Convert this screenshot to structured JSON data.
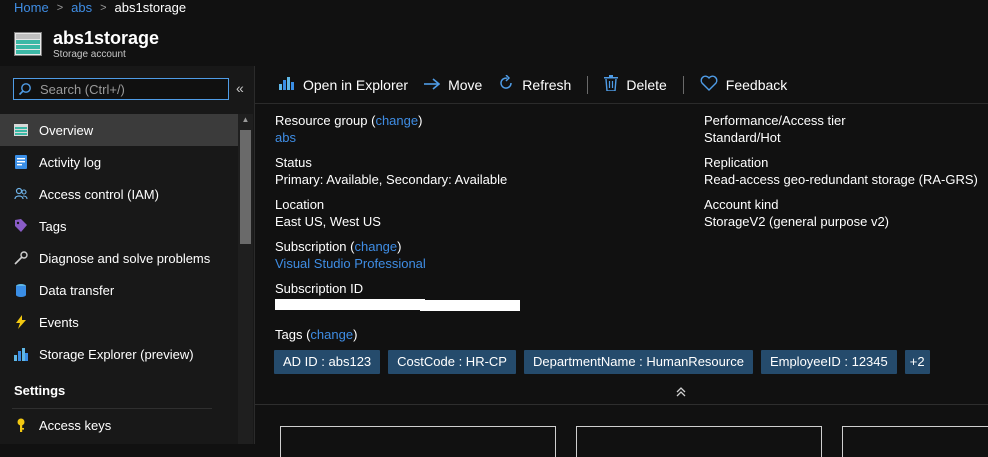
{
  "breadcrumb": {
    "home": "Home",
    "rg": "abs",
    "current": "abs1storage"
  },
  "header": {
    "title": "abs1storage",
    "subtitle": "Storage account"
  },
  "search": {
    "placeholder": "Search (Ctrl+/)"
  },
  "sidebar": {
    "items": [
      {
        "label": "Overview",
        "icon": "overview-icon",
        "active": true
      },
      {
        "label": "Activity log",
        "icon": "activity-log-icon"
      },
      {
        "label": "Access control (IAM)",
        "icon": "iam-icon"
      },
      {
        "label": "Tags",
        "icon": "tag-icon"
      },
      {
        "label": "Diagnose and solve problems",
        "icon": "wrench-icon"
      },
      {
        "label": "Data transfer",
        "icon": "data-transfer-icon"
      },
      {
        "label": "Events",
        "icon": "lightning-icon"
      },
      {
        "label": "Storage Explorer (preview)",
        "icon": "storage-explorer-icon"
      }
    ],
    "section_settings": "Settings",
    "settings_items": [
      {
        "label": "Access keys",
        "icon": "key-icon"
      }
    ],
    "collapse_glyph": "«"
  },
  "toolbar": {
    "open_in_explorer": "Open in Explorer",
    "move": "Move",
    "refresh": "Refresh",
    "delete": "Delete",
    "feedback": "Feedback"
  },
  "essentials": {
    "resource_group_label": "Resource group (",
    "change": "change",
    "close_paren": ")",
    "resource_group_value": "abs",
    "status_label": "Status",
    "status_value": "Primary: Available, Secondary: Available",
    "location_label": "Location",
    "location_value": "East US, West US",
    "subscription_label": "Subscription (",
    "subscription_value": "Visual Studio Professional",
    "subscription_id_label": "Subscription ID",
    "performance_label": "Performance/Access tier",
    "performance_value": "Standard/Hot",
    "replication_label": "Replication",
    "replication_value": "Read-access geo-redundant storage (RA-GRS)",
    "account_kind_label": "Account kind",
    "account_kind_value": "StorageV2 (general purpose v2)"
  },
  "tags": {
    "label": "Tags (",
    "items": [
      "AD ID : abs123",
      "CostCode : HR-CP",
      "DepartmentName : HumanResource",
      "EmployeeID : 12345"
    ],
    "more": "+2"
  },
  "colors": {
    "accent": "#3f8de4",
    "tag_bg": "#254b6c",
    "active_nav": "#3b3b3b"
  }
}
